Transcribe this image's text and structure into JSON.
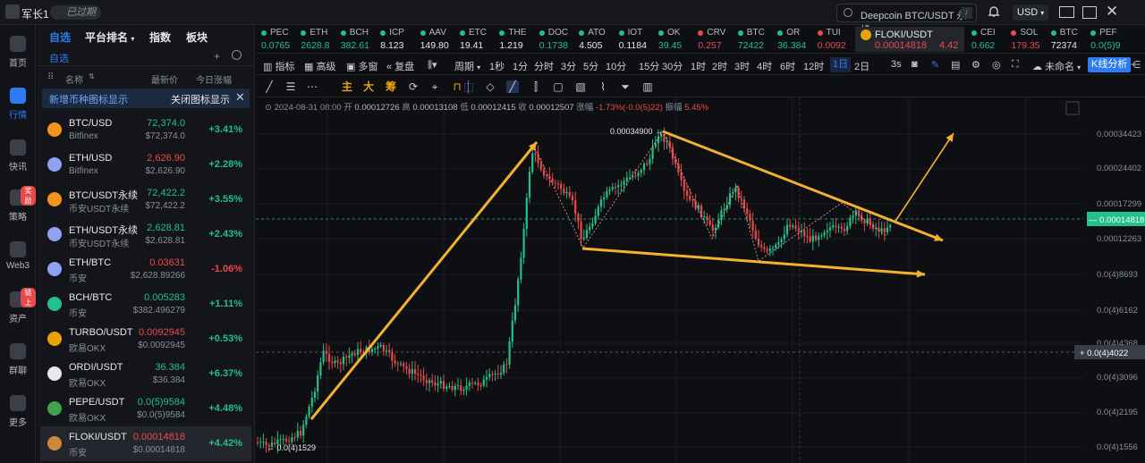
{
  "topbar": {
    "user_name": "军长1",
    "expired_label": "已过期",
    "search_text": "Deepcoin BTC/USDT 永续",
    "search_shortcut": "/",
    "currency": "USD"
  },
  "leftnav": [
    {
      "label": "首页",
      "icon": "home-icon"
    },
    {
      "label": "行情",
      "icon": "chart-icon",
      "active": true
    },
    {
      "label": "快讯",
      "icon": "news-icon"
    },
    {
      "label": "策略",
      "icon": "robot-icon",
      "badge": "奖励"
    },
    {
      "label": "Web3",
      "icon": "web3-icon"
    },
    {
      "label": "资产",
      "icon": "wallet-icon",
      "badge": "链上"
    },
    {
      "label": "群聊",
      "icon": "chat-icon"
    },
    {
      "label": "更多",
      "icon": "grid-icon"
    }
  ],
  "watchlist": {
    "tabs": [
      "自选",
      "平台排名",
      "指数",
      "板块"
    ],
    "sub_tab": "自选",
    "columns": {
      "name": "名称",
      "price": "最新价",
      "change": "今日涨幅"
    },
    "banner_text": "新增币种图标显示",
    "banner_action": "关闭图标显示",
    "rows": [
      {
        "symbol": "BTC/USD",
        "exchange": "Bitfinex",
        "price": "72,374.0",
        "fiat": "$72,374.0",
        "change": "+3.41%",
        "up": true,
        "coin_color": "#f7931a"
      },
      {
        "symbol": "ETH/USD",
        "exchange": "Bitfinex",
        "price": "2,626.90",
        "fiat": "$2,626.90",
        "change": "+2.28%",
        "up": false,
        "chg_up": true,
        "coin_color": "#8ea2f0"
      },
      {
        "symbol": "BTC/USDT永续",
        "exchange": "币安USDT永续",
        "price": "72,422.2",
        "fiat": "$72,422.2",
        "change": "+3.55%",
        "up": true,
        "coin_color": "#f7931a"
      },
      {
        "symbol": "ETH/USDT永续",
        "exchange": "币安USDT永续",
        "price": "2,628.81",
        "fiat": "$2,628.81",
        "change": "+2.43%",
        "up": true,
        "coin_color": "#8ea2f0"
      },
      {
        "symbol": "ETH/BTC",
        "exchange": "币安",
        "price": "0.03631",
        "fiat": "$2,628.89266",
        "change": "-1.06%",
        "up": false,
        "chg_up": false,
        "coin_color": "#8ea2f0"
      },
      {
        "symbol": "BCH/BTC",
        "exchange": "币安",
        "price": "0.005283",
        "fiat": "$382.496279",
        "change": "+1.11%",
        "up": true,
        "coin_color": "#22c08a"
      },
      {
        "symbol": "TURBO/USDT",
        "exchange": "欧易OKX",
        "price": "0.0092945",
        "fiat": "$0.0092945",
        "change": "+0.53%",
        "up": false,
        "chg_up": true,
        "coin_color": "#e8a30c"
      },
      {
        "symbol": "ORDI/USDT",
        "exchange": "欧易OKX",
        "price": "36.384",
        "fiat": "$36.384",
        "change": "+6.37%",
        "up": true,
        "coin_color": "#e6e8ec"
      },
      {
        "symbol": "PEPE/USDT",
        "exchange": "欧易OKX",
        "price": "0.0(5)9584",
        "fiat": "$0.0(5)9584",
        "change": "+4.48%",
        "up": true,
        "coin_color": "#3fa34d"
      },
      {
        "symbol": "FLOKI/USDT",
        "exchange": "币安",
        "price": "0.00014818",
        "fiat": "$0.00014818",
        "change": "+4.42%",
        "up": false,
        "chg_up": true,
        "coin_color": "#c98a3a",
        "selected": true
      }
    ]
  },
  "ticker": [
    {
      "name": "PEC",
      "price": "0.0765",
      "up": true
    },
    {
      "name": "ETH",
      "price": "2628.8",
      "up": true
    },
    {
      "name": "BCH",
      "price": "382.61",
      "up": true
    },
    {
      "name": "ICP",
      "price": "8.123",
      "up": true,
      "white": true
    },
    {
      "name": "AAV",
      "price": "149.80",
      "up": true,
      "white": true
    },
    {
      "name": "ETC",
      "price": "19.41",
      "up": true,
      "white": true
    },
    {
      "name": "THE",
      "price": "1.219",
      "up": true,
      "white": true
    },
    {
      "name": "DOC",
      "price": "0.1738",
      "up": true
    },
    {
      "name": "ATO",
      "price": "4.505",
      "up": true,
      "white": true
    },
    {
      "name": "IOT",
      "price": "0.1184",
      "up": true,
      "white": true
    },
    {
      "name": "OK",
      "price": "39.45",
      "up": true
    },
    {
      "name": "CRV",
      "price": "0.257",
      "up": false
    },
    {
      "name": "BTC",
      "price": "72422",
      "up": true
    },
    {
      "name": "OR",
      "price": "36.384",
      "up": true
    },
    {
      "name": "TUI",
      "price": "0.0092",
      "up": false
    },
    {
      "name": "FLOKI/USDT",
      "price": "0.00014818",
      "change": "4.42",
      "up": false,
      "wide": true
    },
    {
      "name": "CEI",
      "price": "0.662",
      "up": true
    },
    {
      "name": "SOL",
      "price": "179.35",
      "up": false
    },
    {
      "name": "BTC",
      "price": "72374",
      "up": true,
      "white": true
    },
    {
      "name": "PEF",
      "price": "0.0(5)9",
      "up": true
    }
  ],
  "toolbar": {
    "items": [
      "指标",
      "高级",
      "多窗",
      "复盘",
      "",
      "周期"
    ],
    "periods": [
      "1秒",
      "1分",
      "分时",
      "3分",
      "5分",
      "10分",
      "15分",
      "30分",
      "1时",
      "2时",
      "3时",
      "4时",
      "6时",
      "12时",
      "1日",
      "2日"
    ],
    "active_period": "1日",
    "refresh": "3s",
    "layout_name": "未命名",
    "kline_button": "K线分析"
  },
  "drawbar": {
    "cn_tools": [
      "主",
      "大",
      "筹"
    ]
  },
  "chart_data": {
    "type": "candlestick",
    "ohlc_header": {
      "date": "2024-08-31 08:00",
      "open_label": "开",
      "open": "0.00012726",
      "high_label": "高",
      "high": "0.00013108",
      "low_label": "低",
      "low": "0.00012415",
      "close_label": "收",
      "close": "0.00012507",
      "change_label": "涨幅",
      "change": "-1.73%(-0.0(5)22)",
      "amp_label": "振幅",
      "amp": "5.45%"
    },
    "y_ticks": [
      "0.00034423",
      "0.00024402",
      "0.00017299",
      "0.00012263",
      "0.0(4)8693",
      "0.0(4)6162",
      "0.0(4)4368",
      "0.0(4)3096",
      "0.0(4)2195",
      "0.0(4)1556"
    ],
    "current_price": "0.00014818",
    "crosshair_price": "0.0(4)4022",
    "max_label": "0.00034900",
    "min_label": "0.0(4)1529",
    "colors": {
      "up": "#22c08a",
      "down": "#e84a4a",
      "annotation": "#f2b230"
    }
  }
}
